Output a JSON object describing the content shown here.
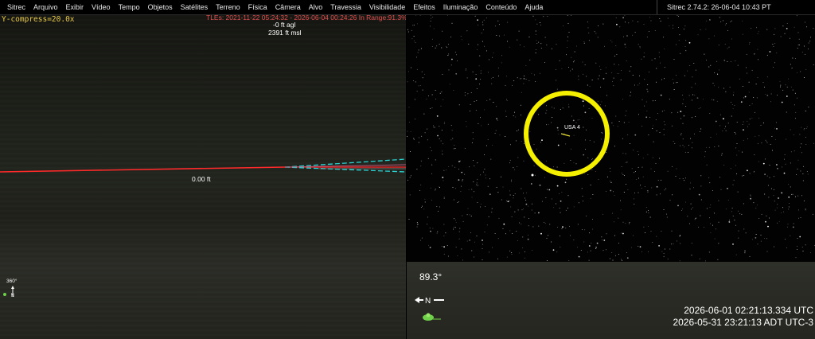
{
  "menu": {
    "items": [
      "Sitrec",
      "Arquivo",
      "Exibir",
      "Vídeo",
      "Tempo",
      "Objetos",
      "Satélites",
      "Terreno",
      "Física",
      "Câmera",
      "Alvo",
      "Travessia",
      "Visibilidade",
      "Efeitos",
      "Iluminação",
      "Conteúdo",
      "Ajuda"
    ]
  },
  "version": "Sitrec 2.74.2: 26-06-04 10:43 PT",
  "left_view": {
    "y_compress": "Y-compress=20.0x",
    "tle_range": "TLEs: 2021-11-22 05:24:32 - 2026-06-04 00:24:26   In Range:91.3%",
    "agl": "-0 ft agl",
    "msl": "2391 ft msl",
    "horizon_label": "0.00 ft",
    "heading": "360°",
    "compass_letter": "N",
    "colors": {
      "horizon": "#ff2a2a",
      "frustum": "#2ad4d4"
    }
  },
  "right_view": {
    "satellite_label": "USA 4",
    "elevation": "89.3°",
    "compass_letter": "N",
    "utc_time": "2026-06-01 02:21:13.334 UTC",
    "local_time": "2026-05-31 23:21:13 ADT UTC-3",
    "colors": {
      "target_ring": "#f5ef00",
      "satellite_trail": "#e8e030"
    }
  }
}
